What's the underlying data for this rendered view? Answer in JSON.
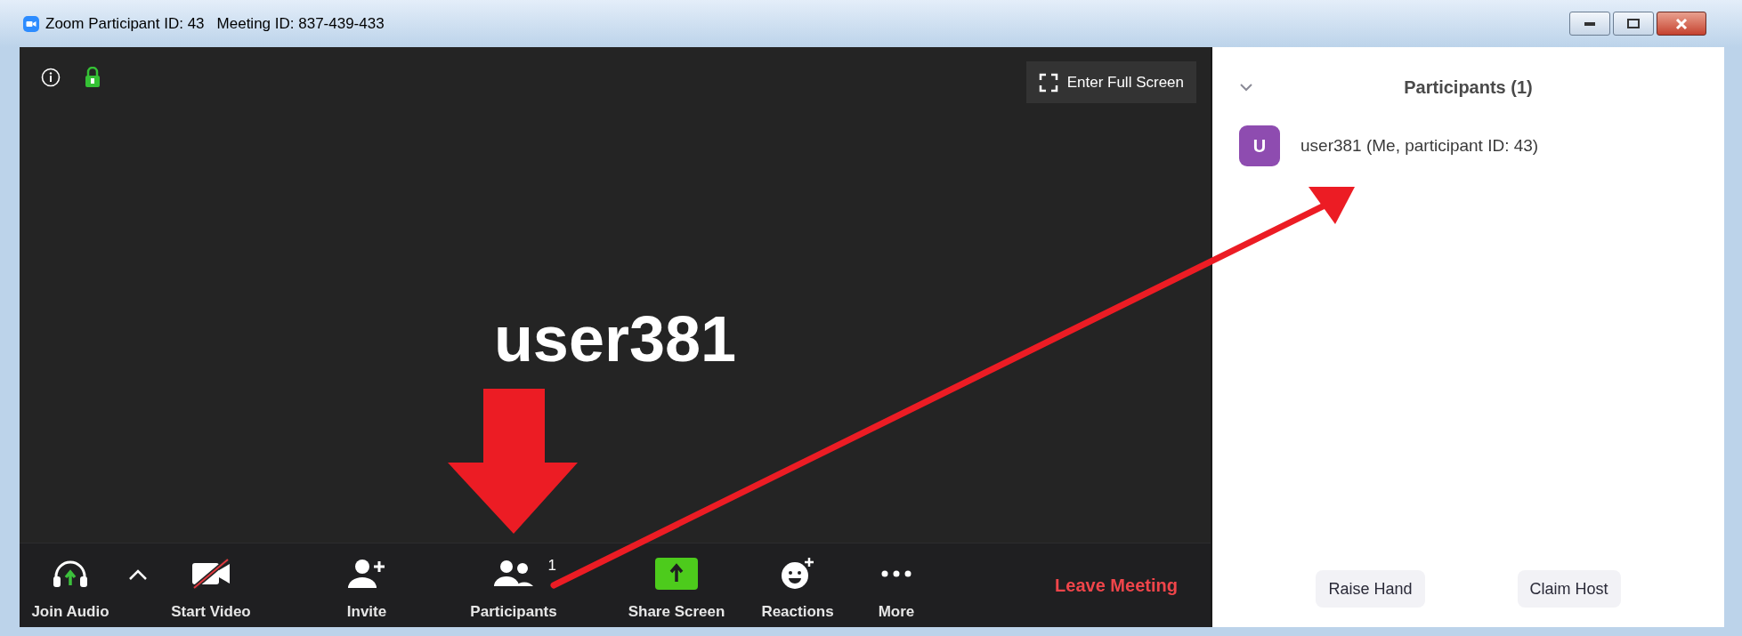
{
  "window": {
    "title": "Zoom Participant ID: 43",
    "meeting_id": "Meeting ID: 837-439-433"
  },
  "video": {
    "fullscreen_button": "Enter Full Screen",
    "participant_name": "user381"
  },
  "toolbar": [
    {
      "kind": "audio",
      "label": "Join Audio"
    },
    {
      "kind": "caret"
    },
    {
      "kind": "video",
      "label": "Start Video"
    },
    {
      "kind": "invite",
      "label": "Invite"
    },
    {
      "kind": "participants",
      "label": "Participants",
      "count": "1"
    },
    {
      "kind": "share",
      "label": "Share Screen"
    },
    {
      "kind": "reactions",
      "label": "Reactions"
    },
    {
      "kind": "more",
      "label": "More"
    },
    {
      "kind": "leave",
      "label": "Leave Meeting"
    }
  ],
  "participants_panel": {
    "title": "Participants (1)",
    "participants": [
      {
        "initial": "U",
        "name": "user381 (Me, participant ID: 43)",
        "color": "#8e4cb0"
      }
    ],
    "buttons": [
      "Raise Hand",
      "Claim Host"
    ]
  }
}
